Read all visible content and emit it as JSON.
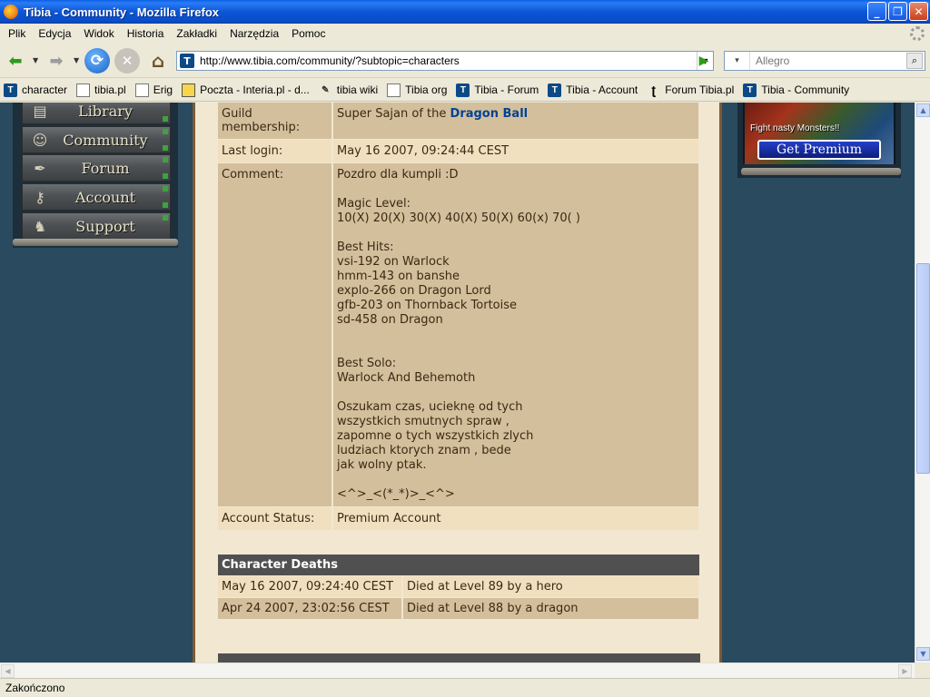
{
  "window": {
    "title": "Tibia - Community - Mozilla Firefox",
    "minimize": "_",
    "maximize": "❐",
    "close": "✕"
  },
  "menu": [
    "Plik",
    "Edycja",
    "Widok",
    "Historia",
    "Zakładki",
    "Narzędzia",
    "Pomoc"
  ],
  "nav": {
    "url": "http://www.tibia.com/community/?subtopic=characters",
    "search_placeholder": "Allegro"
  },
  "bookmarks": [
    {
      "label": "character",
      "icon": "tibia-icon"
    },
    {
      "label": "tibia.pl",
      "icon": "page-icon"
    },
    {
      "label": "Erig",
      "icon": "page-icon"
    },
    {
      "label": "Poczta - Interia.pl - d...",
      "icon": "mail-icon"
    },
    {
      "label": "tibia wiki",
      "icon": "wiki-icon"
    },
    {
      "label": "Tibia org",
      "icon": "page-icon"
    },
    {
      "label": "Tibia - Forum",
      "icon": "tibia-icon"
    },
    {
      "label": "Tibia - Account",
      "icon": "tibia-icon"
    },
    {
      "label": "Forum Tibia.pl",
      "icon": "fancy-t-icon"
    },
    {
      "label": "Tibia - Community",
      "icon": "tibia-icon"
    }
  ],
  "left_menu": [
    "Library",
    "Community",
    "Forum",
    "Account",
    "Support"
  ],
  "character": {
    "guild_label": "Guild membership:",
    "guild_prefix": "Super Sajan of the",
    "guild_name": "Dragon Ball",
    "last_login_label": "Last login:",
    "last_login": "May 16 2007, 09:24:44 CEST",
    "comment_label": "Comment:",
    "comment": "Pozdro dla kumpli :D\n\nMagic Level:\n10(X) 20(X) 30(X) 40(X) 50(X) 60(x) 70( )\n\nBest Hits:\nvsi-192 on Warlock\nhmm-143 on banshe\nexplo-266 on Dragon Lord\ngfb-203 on Thornback Tortoise\nsd-458 on Dragon\n\n\nBest Solo:\nWarlock And Behemoth\n\nOszukam czas, ucieknę od tych\nwszystkich smutnych spraw ,\nzapomne o tych wszystkich zlych\nludziach ktorych znam , bede\njak wolny ptak.\n\n<^>_<(*_*)>_<^>",
    "account_status_label": "Account Status:",
    "account_status": "Premium Account"
  },
  "deaths": {
    "title": "Character Deaths",
    "rows": [
      {
        "date": "May 16 2007, 09:24:40 CEST",
        "text": "Died at Level 89 by a hero"
      },
      {
        "date": "Apr 24 2007, 23:02:56 CEST",
        "text": "Died at Level 88 by a dragon"
      }
    ]
  },
  "premium": {
    "tagline": "Fight nasty Monsters!!",
    "button": "Get Premium"
  },
  "status": "Zakończono",
  "colors": {
    "titlebar": "#0b56d8",
    "page_background": "#294a5f",
    "content_background": "#f2e7d0",
    "row_dark": "#d4bf9c",
    "row_light": "#f1e0c0",
    "header_dark": "#505050",
    "link": "#004294"
  }
}
